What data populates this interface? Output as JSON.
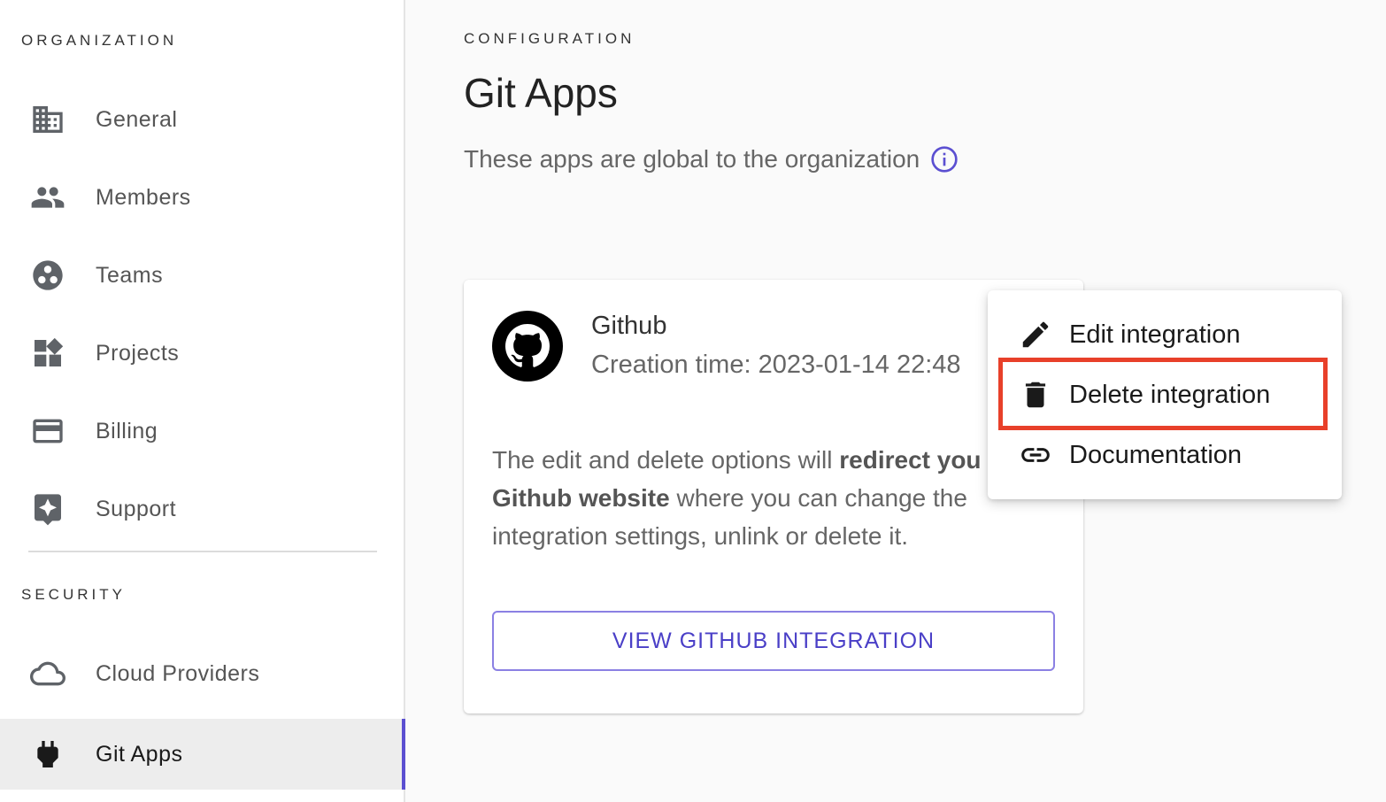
{
  "sidebar": {
    "organization_label": "ORGANIZATION",
    "security_label": "SECURITY",
    "items": [
      {
        "label": "General",
        "icon": "building-icon"
      },
      {
        "label": "Members",
        "icon": "people-icon"
      },
      {
        "label": "Teams",
        "icon": "teams-icon"
      },
      {
        "label": "Projects",
        "icon": "widgets-icon"
      },
      {
        "label": "Billing",
        "icon": "credit-card-icon"
      },
      {
        "label": "Support",
        "icon": "support-icon"
      },
      {
        "label": "Cloud Providers",
        "icon": "cloud-icon"
      },
      {
        "label": "Git Apps",
        "icon": "plug-icon",
        "active": true
      }
    ]
  },
  "main": {
    "overline": "CONFIGURATION",
    "title": "Git Apps",
    "subtitle": "These apps are global to the organization"
  },
  "card": {
    "title": "Github",
    "creation": "Creation time: 2023-01-14 22:48",
    "desc_part1": "The edit and delete options will ",
    "desc_bold1": "redirect you to the Github website",
    "desc_part2": " where you can change the integration settings, unlink or delete it.",
    "button": "VIEW GITHUB INTEGRATION"
  },
  "menu": {
    "items": [
      {
        "label": "Edit integration",
        "icon": "pencil-icon"
      },
      {
        "label": "Delete integration",
        "icon": "trash-icon",
        "highlighted": true
      },
      {
        "label": "Documentation",
        "icon": "link-icon"
      }
    ]
  },
  "colors": {
    "accent": "#5b4fd1",
    "highlight": "#e8402a"
  }
}
